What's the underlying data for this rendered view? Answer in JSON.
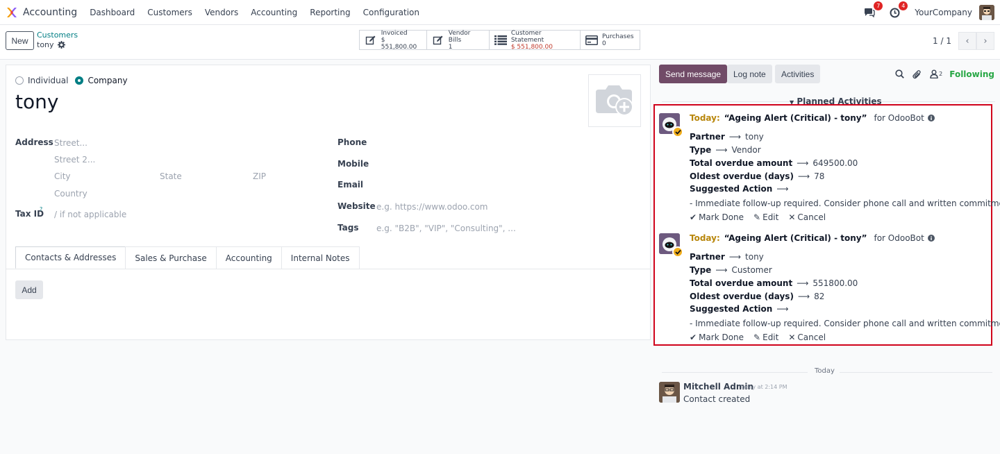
{
  "app": {
    "name": "Accounting",
    "menu": [
      "Dashboard",
      "Customers",
      "Vendors",
      "Accounting",
      "Reporting",
      "Configuration"
    ],
    "messages_count": "7",
    "activities_count": "4",
    "company": "YourCompany"
  },
  "control": {
    "new_label": "New",
    "breadcrumb": "Customers",
    "record_name": "tony",
    "smart_buttons": [
      {
        "label": "Invoiced",
        "value": "$ 551,800.00",
        "icon": "edit-icon",
        "red": false
      },
      {
        "label": "Vendor Bills",
        "value": "1",
        "icon": "edit-icon",
        "red": false
      },
      {
        "label": "Customer Statement",
        "value": "$ 551,800.00",
        "icon": "list-icon",
        "red": true
      },
      {
        "label": "Purchases",
        "value": "0",
        "icon": "credit-card-icon",
        "red": false
      }
    ],
    "pager": "1 / 1"
  },
  "form": {
    "type_individual": "Individual",
    "type_company": "Company",
    "name": "tony",
    "address_label": "Address",
    "street_ph": "Street...",
    "street2_ph": "Street 2...",
    "city_ph": "City",
    "state_ph": "State",
    "zip_ph": "ZIP",
    "country_ph": "Country",
    "taxid_label": "Tax ID",
    "taxid_help": "?",
    "taxid_ph": "/ if not applicable",
    "phone_label": "Phone",
    "mobile_label": "Mobile",
    "email_label": "Email",
    "website_label": "Website",
    "website_ph": "e.g. https://www.odoo.com",
    "tags_label": "Tags",
    "tags_ph": "e.g. \"B2B\", \"VIP\", \"Consulting\", ...",
    "tabs": [
      "Contacts & Addresses",
      "Sales & Purchase",
      "Accounting",
      "Internal Notes"
    ],
    "add_label": "Add"
  },
  "chatter": {
    "send_message": "Send message",
    "log_note": "Log note",
    "activities": "Activities",
    "followers_count": "2",
    "following": "Following",
    "planned_title": "Planned Activities",
    "activities_list": [
      {
        "today": "Today:",
        "title": "“Ageing Alert (Critical) - tony”",
        "for": "for OdooBot",
        "partner_label": "Partner",
        "partner": "tony",
        "type_label": "Type",
        "type": "Vendor",
        "amount_label": "Total overdue amount",
        "amount": "649500.00",
        "days_label": "Oldest overdue (days)",
        "days": "78",
        "action_label": "Suggested Action",
        "note": "- Immediate follow-up required. Consider phone call and written commitment.",
        "mark_done": "Mark Done",
        "edit": "Edit",
        "cancel": "Cancel"
      },
      {
        "today": "Today:",
        "title": "“Ageing Alert (Critical) - tony”",
        "for": "for OdooBot",
        "partner_label": "Partner",
        "partner": "tony",
        "type_label": "Type",
        "type": "Customer",
        "amount_label": "Total overdue amount",
        "amount": "551800.00",
        "days_label": "Oldest overdue (days)",
        "days": "82",
        "action_label": "Suggested Action",
        "note": "- Immediate follow-up required. Consider phone call and written commitment.",
        "mark_done": "Mark Done",
        "edit": "Edit",
        "cancel": "Cancel"
      }
    ],
    "arrow": "⟶",
    "today_sep": "Today",
    "message": {
      "author": "Mitchell Admin",
      "time": "Today at 2:14 PM",
      "body": "Contact created"
    }
  },
  "colors": {
    "brand": "#714b67",
    "link": "#017e84",
    "highlight": "#d0021b",
    "following": "#28a745"
  }
}
